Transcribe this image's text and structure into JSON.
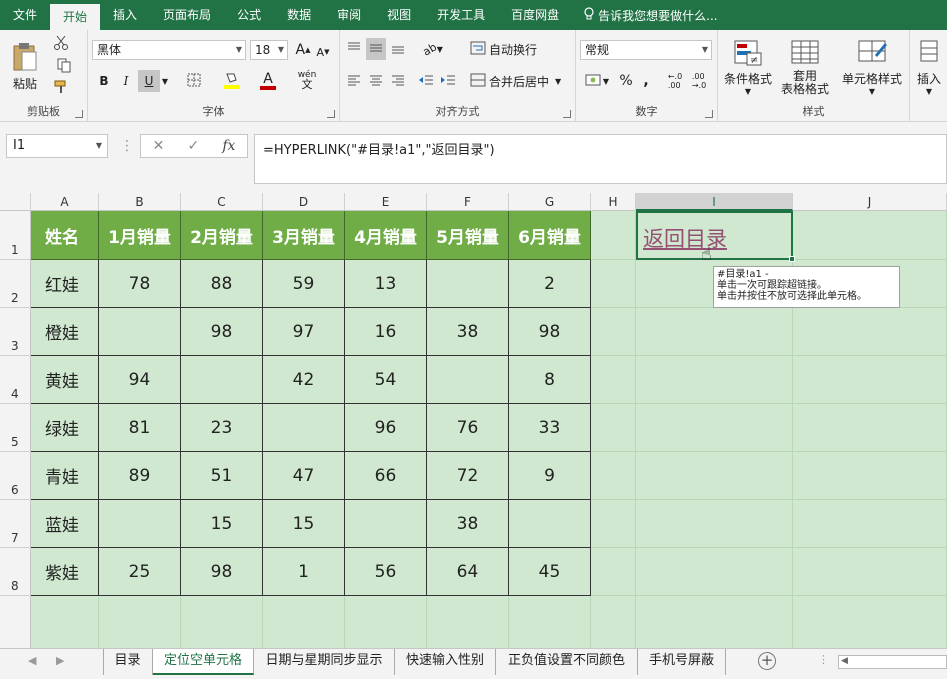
{
  "ribbon_tabs": [
    "文件",
    "开始",
    "插入",
    "页面布局",
    "公式",
    "数据",
    "审阅",
    "视图",
    "开发工具",
    "百度网盘"
  ],
  "active_tab": "开始",
  "tell_me": "告诉我您想要做什么...",
  "clipboard": {
    "paste": "粘贴",
    "label": "剪贴板"
  },
  "font": {
    "name": "黑体",
    "size": "18",
    "bold": "B",
    "italic": "I",
    "underline": "U",
    "phonetic": "wén",
    "font_color_letter": "A",
    "grow": "A",
    "shrink": "A",
    "label": "字体"
  },
  "alignment": {
    "wrap": "自动换行",
    "merge": "合并后居中",
    "label": "对齐方式"
  },
  "number": {
    "format": "常规",
    "percent": "%",
    "comma": ",",
    "label": "数字"
  },
  "styles": {
    "conditional": "条件格式",
    "table_format_1": "套用",
    "table_format_2": "表格格式",
    "cell_styles": "单元格样式",
    "label": "样式"
  },
  "cells": {
    "insert": "插入"
  },
  "accent_color": "#217346",
  "formula_bar": {
    "name_box": "I1",
    "fx": "fx",
    "formula": "=HYPERLINK(\"#目录!a1\",\"返回目录\")"
  },
  "columns": [
    "A",
    "B",
    "C",
    "D",
    "E",
    "F",
    "G",
    "H",
    "I",
    "J"
  ],
  "selected_column": "I",
  "rows": [
    "1",
    "2",
    "3",
    "4",
    "5",
    "6",
    "7",
    "8"
  ],
  "table": {
    "headers": [
      "姓名",
      "1月销量",
      "2月销量",
      "3月销量",
      "4月销量",
      "5月销量",
      "6月销量"
    ],
    "rows": [
      [
        "红娃",
        "78",
        "88",
        "59",
        "13",
        "",
        "2"
      ],
      [
        "橙娃",
        "",
        "98",
        "97",
        "16",
        "38",
        "98"
      ],
      [
        "黄娃",
        "94",
        "",
        "42",
        "54",
        "",
        "8"
      ],
      [
        "绿娃",
        "81",
        "23",
        "",
        "96",
        "76",
        "33"
      ],
      [
        "青娃",
        "89",
        "51",
        "47",
        "66",
        "72",
        "9"
      ],
      [
        "蓝娃",
        "",
        "15",
        "15",
        "",
        "38",
        ""
      ],
      [
        "紫娃",
        "25",
        "98",
        "1",
        "56",
        "64",
        "45"
      ]
    ]
  },
  "header_fill": "#70ad47",
  "sheet_background": "#cfe8cf",
  "link_cell": {
    "text": "返回目录",
    "color": "#954f72"
  },
  "tooltip": {
    "line1": "#目录!a1 -",
    "line2": "单击一次可跟踪超链接。",
    "line3": "单击并按住不放可选择此单元格。"
  },
  "sheet_tabs": [
    "目录",
    "定位空单元格",
    "日期与星期同步显示",
    "快速输入性别",
    "正负值设置不同颜色",
    "手机号屏蔽"
  ],
  "active_sheet": "定位空单元格",
  "add_sheet": "+"
}
